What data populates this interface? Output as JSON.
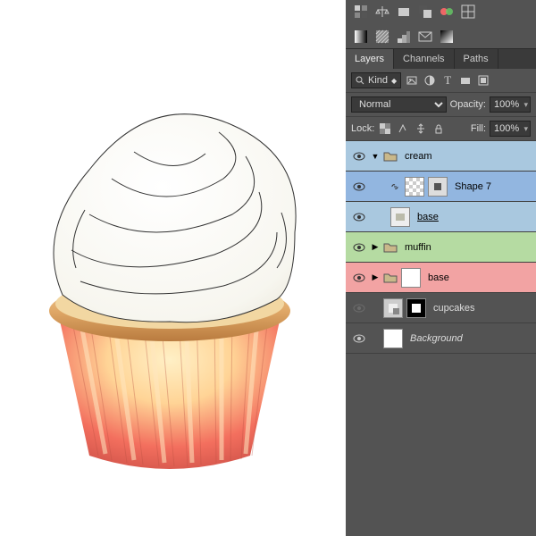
{
  "tabs": {
    "layers": "Layers",
    "channels": "Channels",
    "paths": "Paths"
  },
  "filter": {
    "kind_label": "Kind"
  },
  "blend": {
    "mode": "Normal",
    "opacity_label": "Opacity:",
    "opacity_value": "100%"
  },
  "lock": {
    "label": "Lock:",
    "fill_label": "Fill:",
    "fill_value": "100%"
  },
  "layers": {
    "cream": "cream",
    "shape7": "Shape 7",
    "base1": "base",
    "muffin": "muffin",
    "base2": "base",
    "cupcakes": "cupcakes",
    "background": "Background"
  }
}
